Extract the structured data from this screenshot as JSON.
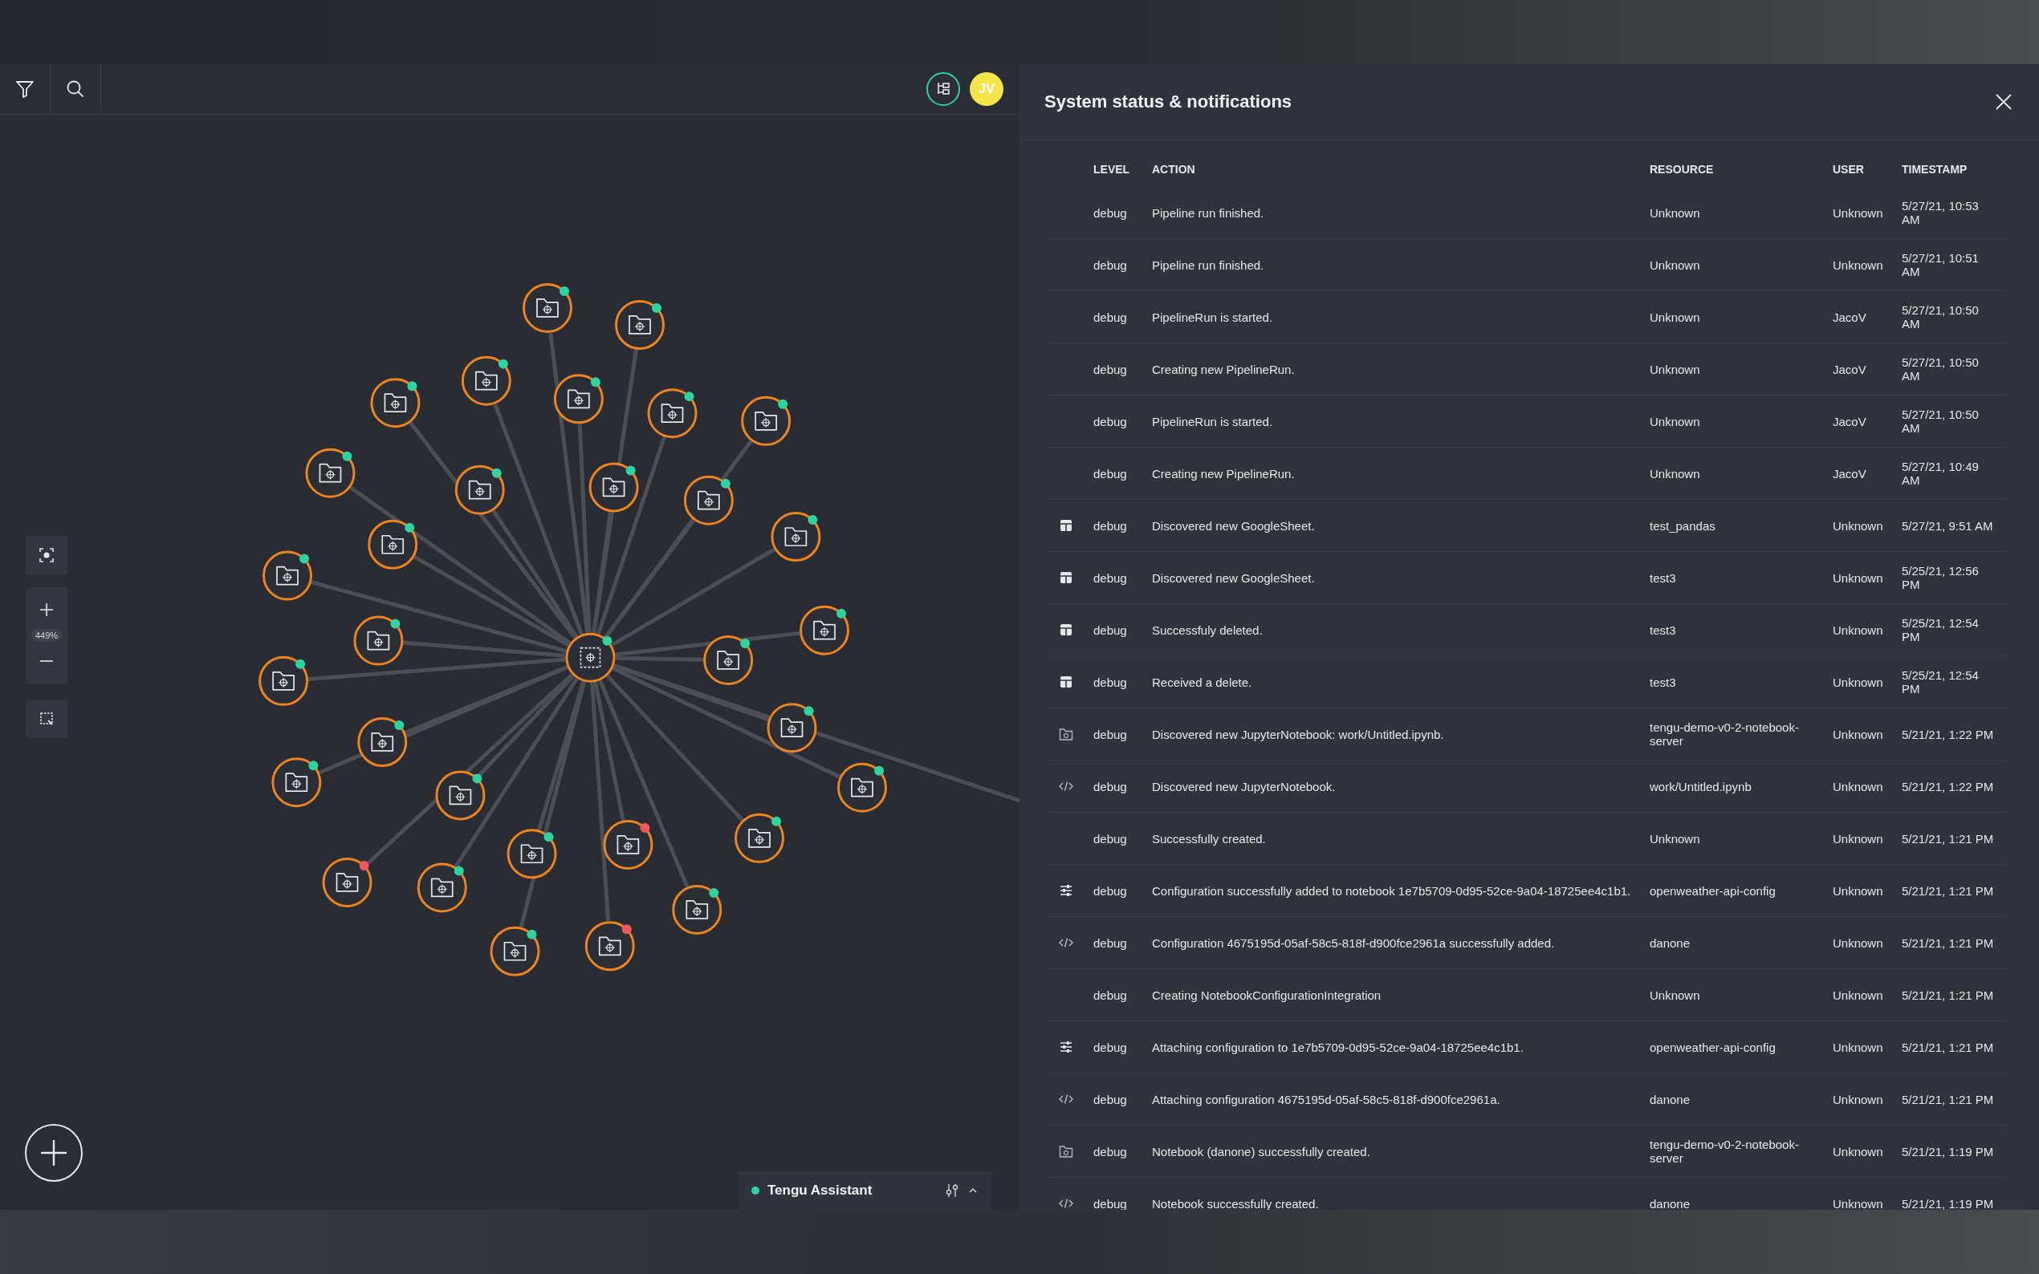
{
  "toolbar": {
    "avatar": "JV"
  },
  "graph": {
    "nodes": [
      {
        "kind": "hub",
        "color": "#2ed3a0"
      },
      {
        "kind": "folder",
        "color": "#2ed3a0"
      },
      {
        "kind": "folder",
        "color": "#2ed3a0"
      },
      {
        "kind": "folder",
        "color": "#2ed3a0"
      },
      {
        "kind": "folder",
        "color": "#2ed3a0"
      },
      {
        "kind": "folder",
        "color": "#2ed3a0"
      },
      {
        "kind": "folder",
        "color": "#2ed3a0"
      },
      {
        "kind": "folder",
        "color": "#2ed3a0"
      },
      {
        "kind": "folder",
        "color": "#2ed3a0"
      },
      {
        "kind": "folder",
        "color": "#2ed3a0"
      },
      {
        "kind": "folder",
        "color": "#2ed3a0"
      },
      {
        "kind": "folder",
        "color": "#2ed3a0"
      },
      {
        "kind": "folder",
        "color": "#2ed3a0"
      },
      {
        "kind": "folder",
        "color": "#2ed3a0"
      },
      {
        "kind": "folder",
        "color": "#2ed3a0"
      },
      {
        "kind": "folder",
        "color": "#2ed3a0"
      },
      {
        "kind": "folder",
        "color": "#2ed3a0"
      },
      {
        "kind": "folder",
        "color": "#2ed3a0"
      },
      {
        "kind": "folder",
        "color": "#2ed3a0"
      },
      {
        "kind": "folder",
        "color": "#2ed3a0"
      },
      {
        "kind": "folder",
        "color": "#2ed3a0"
      },
      {
        "kind": "folder",
        "color": "#2ed3a0"
      },
      {
        "kind": "folder",
        "color": "#2ed3a0"
      },
      {
        "kind": "folder",
        "color": "#2ed3a0"
      },
      {
        "kind": "folder",
        "color": "#2ed3a0"
      },
      {
        "kind": "folder",
        "color": "#2ed3a0"
      },
      {
        "kind": "folder",
        "color": "#f0595c"
      },
      {
        "kind": "folder",
        "color": "#f0595c"
      },
      {
        "kind": "folder",
        "color": "#2ed3a0"
      },
      {
        "kind": "folder",
        "color": "#2ed3a0"
      },
      {
        "kind": "folder",
        "color": "#2ed3a0"
      },
      {
        "kind": "folder",
        "color": "#f0595c"
      }
    ]
  },
  "zoom": {
    "reading": "449%"
  },
  "assistant": {
    "title": "Tengu Assistant"
  },
  "panel": {
    "title": "System status & notifications",
    "columns": [
      "LEVEL",
      "ACTION",
      "RESOURCE",
      "USER",
      "TIMESTAMP"
    ],
    "rows": [
      {
        "kind": "plain",
        "severity": "debug",
        "action": "Pipeline run finished.",
        "resource": "Unknown",
        "user": "Unknown",
        "timestamp": "5/27/21, 10:53 AM"
      },
      {
        "kind": "plain",
        "severity": "debug",
        "action": "Pipeline run finished.",
        "resource": "Unknown",
        "user": "Unknown",
        "timestamp": "5/27/21, 10:51 AM"
      },
      {
        "kind": "plain",
        "severity": "debug",
        "action": "PipelineRun is started.",
        "resource": "Unknown",
        "user": "JacoV",
        "timestamp": "5/27/21, 10:50 AM"
      },
      {
        "kind": "plain",
        "severity": "debug",
        "action": "Creating new PipelineRun.",
        "resource": "Unknown",
        "user": "JacoV",
        "timestamp": "5/27/21, 10:50 AM"
      },
      {
        "kind": "plain",
        "severity": "debug",
        "action": "PipelineRun is started.",
        "resource": "Unknown",
        "user": "JacoV",
        "timestamp": "5/27/21, 10:50 AM"
      },
      {
        "kind": "plain",
        "severity": "debug",
        "action": "Creating new PipelineRun.",
        "resource": "Unknown",
        "user": "JacoV",
        "timestamp": "5/27/21, 10:49 AM"
      },
      {
        "kind": "sheet",
        "severity": "debug",
        "action": "Discovered new GoogleSheet.",
        "resource": "test_pandas",
        "user": "Unknown",
        "timestamp": "5/27/21, 9:51 AM"
      },
      {
        "kind": "sheet",
        "severity": "debug",
        "action": "Discovered new GoogleSheet.",
        "resource": "test3",
        "user": "Unknown",
        "timestamp": "5/25/21, 12:56 PM"
      },
      {
        "kind": "sheet",
        "severity": "debug",
        "action": "Successfuly deleted.",
        "resource": "test3",
        "user": "Unknown",
        "timestamp": "5/25/21, 12:54 PM"
      },
      {
        "kind": "sheet",
        "severity": "debug",
        "action": "Received a delete.",
        "resource": "test3",
        "user": "Unknown",
        "timestamp": "5/25/21, 12:54 PM"
      },
      {
        "kind": "server",
        "severity": "debug",
        "action": "Discovered new JupyterNotebook: work/Untitled.ipynb.",
        "resource": "tengu-demo-v0-2-notebook-server",
        "user": "Unknown",
        "timestamp": "5/21/21, 1:22 PM"
      },
      {
        "kind": "code",
        "severity": "debug",
        "action": "Discovered new JupyterNotebook.",
        "resource": "work/Untitled.ipynb",
        "user": "Unknown",
        "timestamp": "5/21/21, 1:22 PM"
      },
      {
        "kind": "plain",
        "severity": "debug",
        "action": "Successfully created.",
        "resource": "Unknown",
        "user": "Unknown",
        "timestamp": "5/21/21, 1:21 PM"
      },
      {
        "kind": "config",
        "severity": "debug",
        "action": "Configuration successfully added to notebook 1e7b5709-0d95-52ce-9a04-18725ee4c1b1.",
        "resource": "openweather-api-config",
        "user": "Unknown",
        "timestamp": "5/21/21, 1:21 PM"
      },
      {
        "kind": "code",
        "severity": "debug",
        "action": "Configuration 4675195d-05af-58c5-818f-d900fce2961a successfully added.",
        "resource": "danone",
        "user": "Unknown",
        "timestamp": "5/21/21, 1:21 PM"
      },
      {
        "kind": "plain",
        "severity": "debug",
        "action": "Creating NotebookConfigurationIntegration",
        "resource": "Unknown",
        "user": "Unknown",
        "timestamp": "5/21/21, 1:21 PM"
      },
      {
        "kind": "config",
        "severity": "debug",
        "action": "Attaching configuration to 1e7b5709-0d95-52ce-9a04-18725ee4c1b1.",
        "resource": "openweather-api-config",
        "user": "Unknown",
        "timestamp": "5/21/21, 1:21 PM"
      },
      {
        "kind": "code",
        "severity": "debug",
        "action": "Attaching configuration 4675195d-05af-58c5-818f-d900fce2961a.",
        "resource": "danone",
        "user": "Unknown",
        "timestamp": "5/21/21, 1:21 PM"
      },
      {
        "kind": "server",
        "severity": "debug",
        "action": "Notebook (danone) successfully created.",
        "resource": "tengu-demo-v0-2-notebook-server",
        "user": "Unknown",
        "timestamp": "5/21/21, 1:19 PM"
      },
      {
        "kind": "code",
        "severity": "debug",
        "action": "Notebook successfully created.",
        "resource": "danone",
        "user": "Unknown",
        "timestamp": "5/21/21, 1:19 PM"
      }
    ]
  }
}
